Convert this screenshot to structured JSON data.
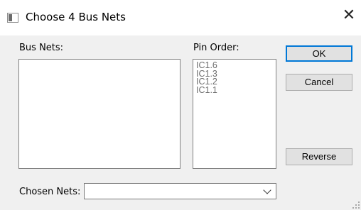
{
  "window": {
    "title": "Choose 4 Bus Nets",
    "close_glyph": "✕"
  },
  "bus_nets": {
    "label": "Bus Nets:",
    "items": []
  },
  "pin_order": {
    "label": "Pin Order:",
    "items": [
      "IC1.6",
      "IC1.3",
      "IC1.2",
      "IC1.1"
    ]
  },
  "buttons": {
    "ok": "OK",
    "cancel": "Cancel",
    "reverse": "Reverse"
  },
  "chosen_nets": {
    "label": "Chosen Nets:",
    "value": ""
  },
  "colors": {
    "dialog_bg": "#f0f0f0",
    "default_button_border": "#0078d7",
    "disabled_text": "#6d6d6d"
  }
}
